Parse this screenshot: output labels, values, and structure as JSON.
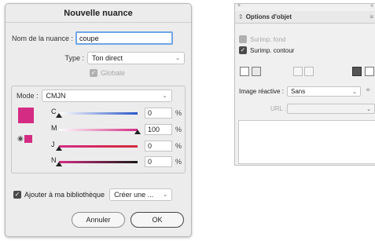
{
  "dialog": {
    "title": "Nouvelle nuance",
    "name_label": "Nom de la nuance :",
    "name_value": "coupe",
    "type_label": "Type :",
    "type_value": "Ton direct",
    "globale_label": "Globale",
    "mode_label": "Mode :",
    "mode_value": "CMJN",
    "swatch_color": "#d42c83",
    "channels": [
      {
        "label": "C",
        "value": "0",
        "unit": "%",
        "level": 0
      },
      {
        "label": "M",
        "value": "100",
        "unit": "%",
        "level": 100
      },
      {
        "label": "J",
        "value": "0",
        "unit": "%",
        "level": 0
      },
      {
        "label": "N",
        "value": "0",
        "unit": "%",
        "level": 0
      }
    ],
    "add_library_label": "Ajouter à ma bibliothèque",
    "library_value": "Créer une ...",
    "cancel_label": "Annuler",
    "ok_label": "OK"
  },
  "panel": {
    "close_glyph": "×",
    "collapse_glyph": "«",
    "tab_label": "Options d'objet",
    "surimp_fond_label": "Surimp. fond",
    "surimp_contour_label": "Surimp. contour",
    "image_reactive_label": "Image réactive :",
    "image_reactive_value": "Sans",
    "url_label": "URL :"
  }
}
